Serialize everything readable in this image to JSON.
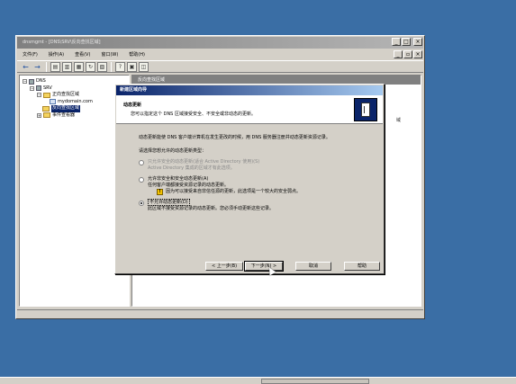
{
  "mmc": {
    "title": "dnsmgmt - [DNS\\SRV\\反向查找区域]",
    "menu": [
      "文件(F)",
      "操作(A)",
      "查看(V)",
      "窗口(W)",
      "帮助(H)"
    ],
    "tree": [
      {
        "label": "DNS",
        "level": 0,
        "icon": "dns-icon"
      },
      {
        "label": "SRV",
        "level": 1,
        "icon": "server-icon"
      },
      {
        "label": "正向查找区域",
        "level": 2,
        "icon": "folder-icon"
      },
      {
        "label": "mydomain.com",
        "level": 3,
        "icon": "zone-icon"
      },
      {
        "label": "反向查找区域",
        "level": 2,
        "icon": "folder-icon",
        "selected": true
      },
      {
        "label": "事件查看器",
        "level": 2,
        "icon": "folder-icon"
      }
    ],
    "right_header": "反向查找区域",
    "right_fragment": "域"
  },
  "wizard": {
    "title": "新建区域向导",
    "header_title": "动态更新",
    "header_subtitle": "您可以指定这个 DNS 区域接受安全、不安全或非动态的更新。",
    "intro": "动态更新能使 DNS 客户端计算机在发生更改的时候，用 DNS 服务器注册并动态更新资源记录。",
    "prompt": "请选择您想允许的动态更新类型：",
    "options": [
      {
        "label": "只允许安全的动态更新(适合 Active Directory 使用)(S)",
        "desc": "Active Directory 集成的区域才有此选项。",
        "disabled": true,
        "checked": false
      },
      {
        "label": "允许非安全和安全动态更新(A)",
        "desc": "任何客户端都接受资源记录的动态更新。",
        "warning": "因为可以接受来自非信任源的更新，此选项是一个较大的安全弱点。",
        "disabled": false,
        "checked": false
      },
      {
        "label": "不允许动态更新(D)",
        "desc": "此区域不接受资源记录的动态更新。您必须手动更新这些记录。",
        "disabled": false,
        "checked": true
      }
    ],
    "buttons": {
      "back": "< 上一步(B)",
      "next": "下一步(N) >",
      "cancel": "取消",
      "help": "帮助"
    }
  }
}
